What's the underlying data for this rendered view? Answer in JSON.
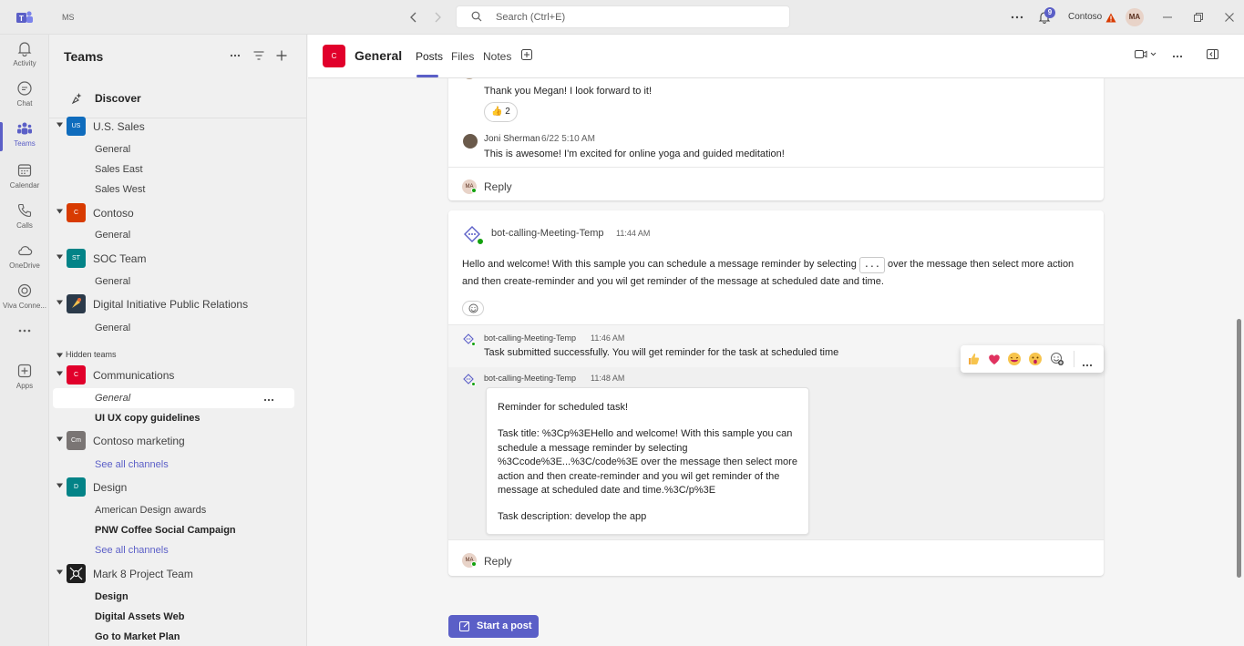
{
  "titlebar": {
    "org_short": "MS",
    "search_placeholder": "Search (Ctrl+E)",
    "notification_count": "9",
    "org_name": "Contoso",
    "user_initials": "MA"
  },
  "rail": {
    "items": [
      {
        "label": "Activity",
        "icon": "bell-icon"
      },
      {
        "label": "Chat",
        "icon": "chat-icon"
      },
      {
        "label": "Teams",
        "icon": "teams-icon"
      },
      {
        "label": "Calendar",
        "icon": "calendar-icon"
      },
      {
        "label": "Calls",
        "icon": "phone-icon"
      },
      {
        "label": "OneDrive",
        "icon": "cloud-icon"
      },
      {
        "label": "Viva Conne...",
        "icon": "viva-icon"
      },
      {
        "label": "Apps",
        "icon": "apps-icon"
      }
    ]
  },
  "teams_panel": {
    "title": "Teams",
    "discover": "Discover",
    "hidden_teams_label": "Hidden teams",
    "teams": [
      {
        "initials": "US",
        "name": "U.S. Sales",
        "color": "#0f6cbd"
      },
      {
        "initials": "C",
        "name": "Contoso",
        "color": "#d83b01"
      },
      {
        "initials": "ST",
        "name": "SOC Team",
        "color": "#038387"
      },
      {
        "initials": "",
        "name": "Digital Initiative Public Relations",
        "color": "#2b3a4a"
      },
      {
        "initials": "C",
        "name": "Communications",
        "color": "#e1002b"
      },
      {
        "initials": "Cm",
        "name": "Contoso marketing",
        "color": "#7a7574"
      },
      {
        "initials": "D",
        "name": "Design",
        "color": "#038387"
      },
      {
        "initials": "",
        "name": "Mark 8 Project Team",
        "color": "#1f1f1f"
      }
    ],
    "channels": {
      "us_general": "General",
      "us_east": "Sales East",
      "us_west": "Sales West",
      "contoso_general": "General",
      "soc_general": "General",
      "dipr_general": "General",
      "comm_general": "General",
      "comm_ui": "UI UX copy guidelines",
      "cm_see_all": "See all channels",
      "design_awards": "American Design awards",
      "design_pnw": "PNW Coffee Social Campaign",
      "design_see_all": "See all channels",
      "m8_design": "Design",
      "m8_assets": "Digital Assets Web",
      "m8_market": "Go to Market Plan"
    }
  },
  "channel_header": {
    "team_initial": "C",
    "title": "General",
    "tabs": [
      "Posts",
      "Files",
      "Notes"
    ]
  },
  "thread1": {
    "msg1_text": "Thank you Megan! I look forward to it!",
    "reaction_count": "2",
    "msg2_sender": "Joni Sherman",
    "msg2_time": "6/22 5:10 AM",
    "msg2_text": "This is awesome! I'm excited for online yoga and guided meditation!",
    "reply": "Reply",
    "reply_initials": "MA"
  },
  "thread2": {
    "sender": "bot-calling-Meeting-Temp",
    "time": "11:44 AM",
    "text_before": "Hello and welcome! With this sample you can schedule a message reminder by selecting",
    "inline_code": "...",
    "text_after": "over the message then select more action",
    "text_line2": "and then create-reminder and you wil get reminder of the message at scheduled date and time.",
    "reply1_sender": "bot-calling-Meeting-Temp",
    "reply1_time": "11:46 AM",
    "reply1_text": "Task submitted successfully. You will get reminder for the task at scheduled time",
    "reply2_sender": "bot-calling-Meeting-Temp",
    "reply2_time": "11:48 AM",
    "card_title": "Reminder for scheduled task!",
    "card_task_title": "Task title: %3Cp%3EHello and welcome! With this sample you can schedule a message reminder by selecting %3Ccode%3E...%3C/code%3E over the message then select more action and then create-reminder and you wil get reminder of the message at scheduled date and time.%3C/p%3E",
    "card_task_desc": "Task description: develop the app",
    "reply": "Reply",
    "reply_initials": "MA"
  },
  "start_post": "Start a post",
  "colors": {
    "brand": "#5b5fc7",
    "presence": "#13a10e"
  }
}
